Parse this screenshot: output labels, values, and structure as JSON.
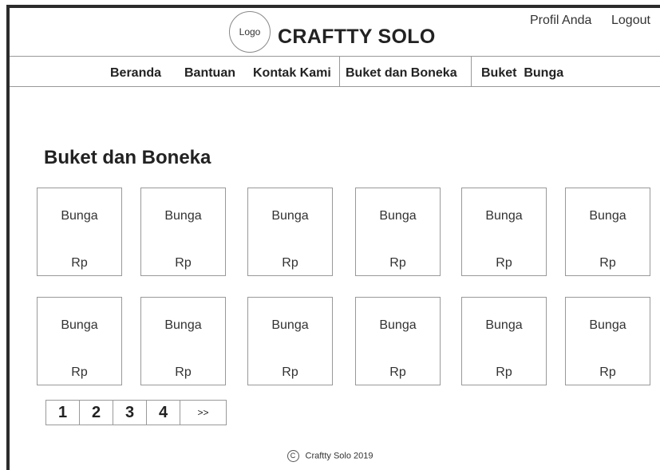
{
  "header": {
    "logo_text": "Logo",
    "brand": "CRAFTTY SOLO",
    "profile_link": "Profil Anda",
    "logout_link": "Logout"
  },
  "nav": {
    "items": [
      "Beranda",
      "Bantuan",
      "Kontak Kami",
      "Buket dan Boneka",
      "Buket  Bunga"
    ]
  },
  "main": {
    "section_title": "Buket dan Boneka",
    "products": [
      {
        "name": "Bunga",
        "price": "Rp"
      },
      {
        "name": "Bunga",
        "price": "Rp"
      },
      {
        "name": "Bunga",
        "price": "Rp"
      },
      {
        "name": "Bunga",
        "price": "Rp"
      },
      {
        "name": "Bunga",
        "price": "Rp"
      },
      {
        "name": "Bunga",
        "price": "Rp"
      },
      {
        "name": "Bunga",
        "price": "Rp"
      },
      {
        "name": "Bunga",
        "price": "Rp"
      },
      {
        "name": "Bunga",
        "price": "Rp"
      },
      {
        "name": "Bunga",
        "price": "Rp"
      },
      {
        "name": "Bunga",
        "price": "Rp"
      },
      {
        "name": "Bunga",
        "price": "Rp"
      }
    ]
  },
  "pagination": {
    "pages": [
      "1",
      "2",
      "3",
      "4"
    ],
    "next": ">>"
  },
  "footer": {
    "copyright_symbol": "C",
    "text": "Craftty Solo 2019"
  }
}
